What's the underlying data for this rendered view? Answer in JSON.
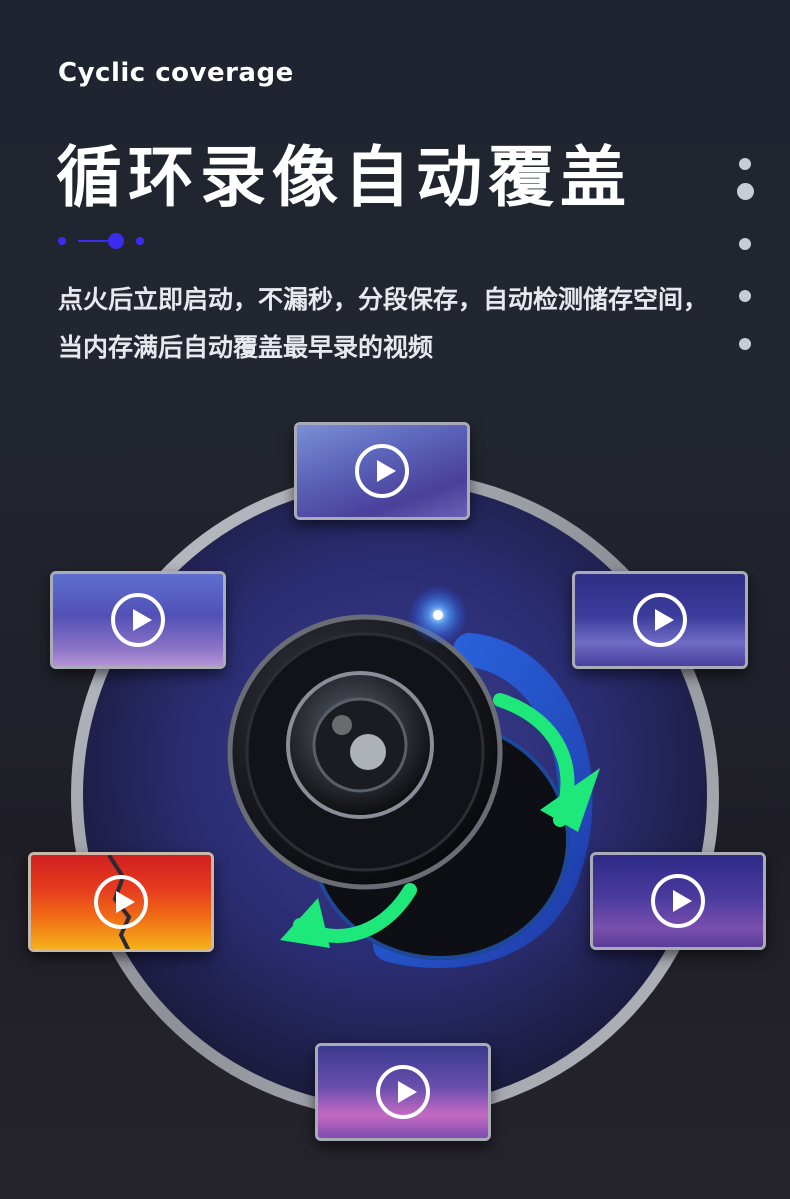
{
  "header": {
    "subtitle_en": "Cyclic coverage",
    "title_cn": "循环录像自动覆盖",
    "description": "点火后立即启动，不漏秒，分段保存，自动检测储存空间，当内存满后自动覆盖最早录的视频"
  },
  "thumbnails": [
    {
      "id": "top",
      "icon": "play-icon"
    },
    {
      "id": "left",
      "icon": "play-icon"
    },
    {
      "id": "right",
      "icon": "play-icon"
    },
    {
      "id": "bottom-left-broken",
      "icon": "play-icon"
    },
    {
      "id": "bottom-right",
      "icon": "play-icon"
    },
    {
      "id": "bottom",
      "icon": "play-icon"
    }
  ],
  "colors": {
    "accent_blue": "#3b2cf0",
    "loop_arrow_green": "#1ee87a",
    "loop_arrow_blue": "#2f7df2",
    "ring": "#a6a8b0"
  }
}
